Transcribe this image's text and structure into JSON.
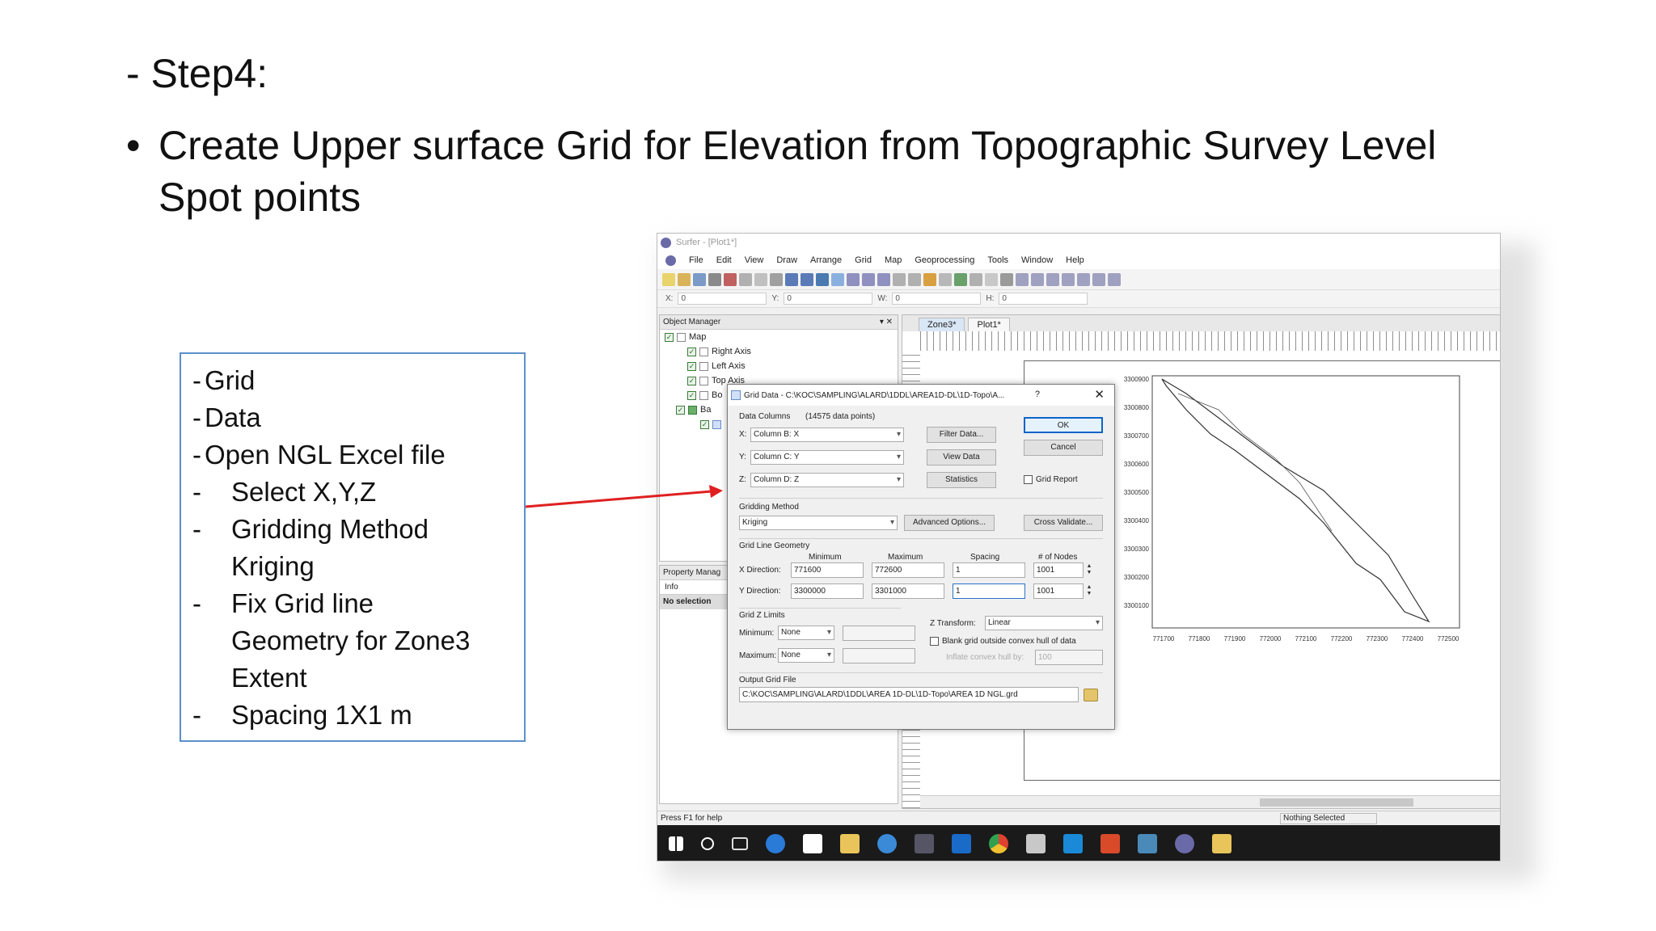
{
  "slide": {
    "step_title": "- Step4:",
    "bullet_symbol": "•",
    "bullet_text": "Create Upper surface Grid for Elevation from Topographic Survey Level Spot points"
  },
  "instructions": {
    "lines": [
      {
        "dash": "-",
        "text": "Grid"
      },
      {
        "dash": "-",
        "text": "Data"
      },
      {
        "dash": "-",
        "text": "Open NGL Excel file"
      },
      {
        "dash": "-",
        "text": "Select X,Y,Z"
      },
      {
        "dash": "-",
        "text": "Gridding Method"
      },
      {
        "cont": "Kriging"
      },
      {
        "dash": "-",
        "text": "Fix Grid line"
      },
      {
        "cont": "Geometry for Zone3"
      },
      {
        "cont": "Extent"
      },
      {
        "dash": "-",
        "text": "Spacing 1X1 m"
      }
    ]
  },
  "app": {
    "title": "Surfer - [Plot1*]",
    "menu": [
      "File",
      "Edit",
      "View",
      "Draw",
      "Arrange",
      "Grid",
      "Map",
      "Geoprocessing",
      "Tools",
      "Window",
      "Help"
    ],
    "coords": {
      "x_label": "X:",
      "x_value": "0",
      "y_label": "Y:",
      "y_value": "0",
      "w_label": "W:",
      "w_value": "0",
      "h_label": "H:",
      "h_value": "0"
    },
    "object_manager": {
      "title": "Object Manager",
      "items": [
        "Map",
        "Right Axis",
        "Left Axis",
        "Top Axis",
        "Bo",
        "Ba"
      ]
    },
    "property_manager": {
      "title": "Property Manag",
      "tab": "Info",
      "selection": "No selection"
    },
    "doc_tabs": [
      "Zone3*",
      "Plot1*"
    ],
    "status_left": "Press F1 for help",
    "status_right": "Nothing Selected"
  },
  "dialog": {
    "title": "Grid Data - C:\\KOC\\SAMPLING\\ALARD\\1DDL\\AREA1D-DL\\1D-Topo\\A...",
    "help": "?",
    "close": "✕",
    "data_columns_label": "Data Columns",
    "data_points": "(14575 data points)",
    "x_label": "X:",
    "x_value": "Column B:  X",
    "y_label": "Y:",
    "y_value": "Column C:  Y",
    "z_label": "Z:",
    "z_value": "Column D:  Z",
    "filter_data": "Filter Data...",
    "view_data": "View Data",
    "statistics": "Statistics",
    "ok": "OK",
    "cancel": "Cancel",
    "grid_report": "Grid Report",
    "gridding_method_label": "Gridding Method",
    "gridding_method": "Kriging",
    "advanced_options": "Advanced Options...",
    "cross_validate": "Cross Validate...",
    "grid_line_geometry": "Grid Line Geometry",
    "col_min": "Minimum",
    "col_max": "Maximum",
    "col_spacing": "Spacing",
    "col_nodes": "# of Nodes",
    "x_dir_label": "X Direction:",
    "x_min": "771600",
    "x_max": "772600",
    "x_spacing": "1",
    "x_nodes": "1001",
    "y_dir_label": "Y Direction:",
    "y_min": "3300000",
    "y_max": "3301000",
    "y_spacing": "1",
    "y_nodes": "1001",
    "grid_z_limits": "Grid Z Limits",
    "minimum_label": "Minimum:",
    "minimum_value": "None",
    "maximum_label": "Maximum:",
    "maximum_value": "None",
    "z_transform_label": "Z Transform:",
    "z_transform": "Linear",
    "blank_grid": "Blank grid outside convex hull of data",
    "inflate_label": "Inflate convex hull by:",
    "inflate_value": "100",
    "output_grid_file": "Output Grid File",
    "output_path": "C:\\KOC\\SAMPLING\\ALARD\\1DDL\\AREA 1D-DL\\1D-Topo\\AREA 1D NGL.grd"
  },
  "map": {
    "y_ticks": [
      "3300900",
      "3300800",
      "3300700",
      "3300600",
      "3300500",
      "3300400",
      "3300300",
      "3300200",
      "3300100"
    ],
    "x_ticks": [
      "771700",
      "771800",
      "771900",
      "772000",
      "772100",
      "772200",
      "772300",
      "772400",
      "772500"
    ]
  },
  "colors": {
    "box_border": "#5b8fc9",
    "arrow": "#e02020",
    "ok_border": "#0a64c8"
  }
}
